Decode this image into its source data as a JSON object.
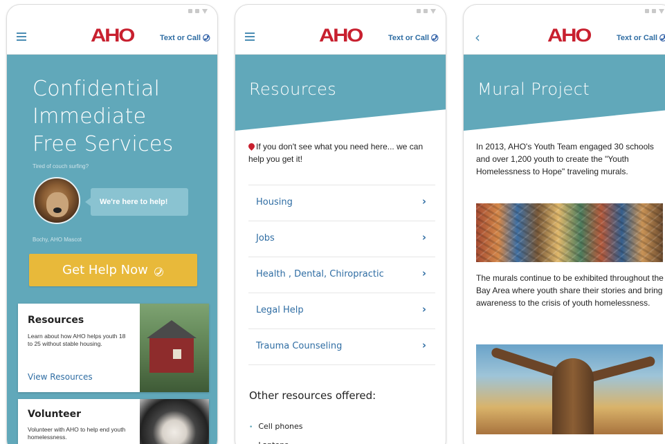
{
  "colors": {
    "teal": "#61a8ba",
    "brand_red": "#c8202f",
    "link_blue": "#2f6da3",
    "cta_yellow": "#e8b93a"
  },
  "header": {
    "logo_text": "AHO",
    "text_call_label": "Text or Call",
    "phone_icon": "phone-icon",
    "menu_icon": "menu-icon",
    "back_icon": "back-icon"
  },
  "home": {
    "headline": [
      "Confidential",
      "Immediate",
      "Free Services"
    ],
    "tagline": "Tired of couch surfing?",
    "bubble": "We're here to help!",
    "mascot_caption": "Bochy, AHO Mascot",
    "cta_label": "Get Help Now",
    "cards": [
      {
        "title": "Resources",
        "desc": "Learn about how AHO helps youth 18 to 25 without stable housing.",
        "link": "View Resources"
      },
      {
        "title": "Volunteer",
        "desc": "Volunteer with AHO to help end youth homelessness.",
        "link": ""
      }
    ]
  },
  "resources": {
    "title": "Resources",
    "intro": "If you don't see what you need here... we can help you get it!",
    "items": [
      "Housing",
      "Jobs",
      "Health , Dental, Chiropractic",
      "Legal Help",
      "Trauma Counseling"
    ],
    "chevron": "›",
    "other_title": "Other resources offered:",
    "other_items": [
      "Cell phones",
      "Laptops"
    ]
  },
  "mural": {
    "title": "Mural Project",
    "para1": "In 2013, AHO's Youth Team engaged 30 schools and over 1,200 youth to create the \"Youth Homelessness to Hope\" traveling murals.",
    "para2": "The murals continue to be exhibited throughout the Bay Area where youth share their stories and bring awareness to the crisis of youth homelessness."
  }
}
